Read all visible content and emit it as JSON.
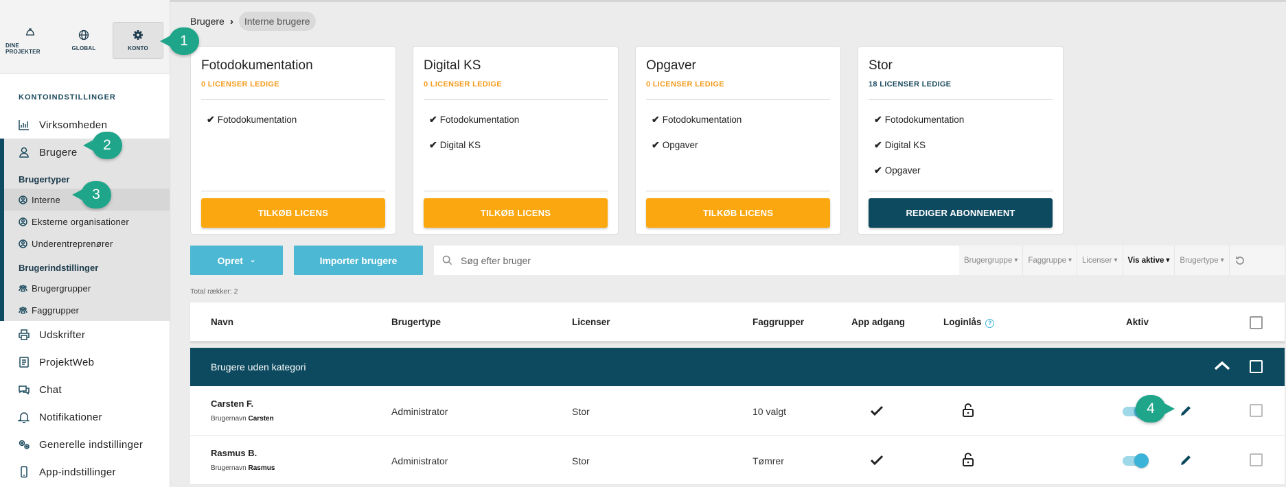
{
  "topnav": [
    {
      "label": "DINE PROJEKTER",
      "icon": "helmet-icon"
    },
    {
      "label": "GLOBAL",
      "icon": "globe-icon"
    },
    {
      "label": "KONTO",
      "icon": "gear-icon"
    }
  ],
  "sidebar": {
    "heading": "KONTOINDSTILLINGER",
    "items": [
      {
        "label": "Virksomheden",
        "icon": "chart-icon"
      },
      {
        "label": "Brugere",
        "icon": "user-icon"
      },
      {
        "label": "Udskrifter",
        "icon": "printer-icon"
      },
      {
        "label": "ProjektWeb",
        "icon": "web-icon"
      },
      {
        "label": "Chat",
        "icon": "chat-icon"
      },
      {
        "label": "Notifikationer",
        "icon": "bell-icon"
      },
      {
        "label": "Generelle indstillinger",
        "icon": "cogs-icon"
      },
      {
        "label": "App-indstillinger",
        "icon": "phone-icon"
      }
    ],
    "brugertyper_heading": "Brugertyper",
    "brugertyper": [
      "Interne",
      "Eksterne organisationer",
      "Underentreprenører"
    ],
    "brugerindstillinger_heading": "Brugerindstillinger",
    "brugerindstillinger": [
      "Brugergrupper",
      "Faggrupper"
    ]
  },
  "breadcrumb": [
    "Brugere",
    "Interne brugere"
  ],
  "cards": [
    {
      "title": "Fotodokumentation",
      "sub": "0 LICENSER LEDIGE",
      "sub_color": "orange",
      "features": [
        "Fotodokumentation"
      ],
      "button": "TILKØB LICENS",
      "button_style": "orange"
    },
    {
      "title": "Digital KS",
      "sub": "0 LICENSER LEDIGE",
      "sub_color": "orange",
      "features": [
        "Fotodokumentation",
        "Digital KS"
      ],
      "button": "TILKØB LICENS",
      "button_style": "orange"
    },
    {
      "title": "Opgaver",
      "sub": "0 LICENSER LEDIGE",
      "sub_color": "orange",
      "features": [
        "Fotodokumentation",
        "Opgaver"
      ],
      "button": "TILKØB LICENS",
      "button_style": "orange"
    },
    {
      "title": "Stor",
      "sub": "18 LICENSER LEDIGE",
      "sub_color": "blue",
      "features": [
        "Fotodokumentation",
        "Digital KS",
        "Opgaver"
      ],
      "button": "REDIGER ABONNEMENT",
      "button_style": "dark"
    }
  ],
  "toolbar": {
    "create_label": "Opret",
    "import_label": "Importer brugere",
    "search_placeholder": "Søg efter bruger",
    "filters": [
      "Brugergruppe",
      "Faggruppe",
      "Licenser",
      "Vis aktive",
      "Brugertype"
    ],
    "active_filter": "Vis aktive"
  },
  "total": "Total rækker: 2",
  "table": {
    "headers": [
      "Navn",
      "Brugertype",
      "Licenser",
      "Faggrupper",
      "App adgang",
      "Loginlås",
      "Aktiv"
    ],
    "group_label": "Brugere uden kategori",
    "username_prefix": "Brugernavn",
    "rows": [
      {
        "name": "Carsten F.",
        "username": "Carsten",
        "type": "Administrator",
        "license": "Stor",
        "faggrupper": "10 valgt",
        "app": true,
        "active": true
      },
      {
        "name": "Rasmus B.",
        "username": "Rasmus",
        "type": "Administrator",
        "license": "Stor",
        "faggrupper": "Tømrer",
        "app": true,
        "active": true
      }
    ]
  },
  "callouts": [
    "1",
    "2",
    "3",
    "4"
  ],
  "colors": {
    "accent": "#0d4a60",
    "orange": "#fba70f",
    "cyan": "#4db8d3",
    "callout": "#1fa58a"
  }
}
